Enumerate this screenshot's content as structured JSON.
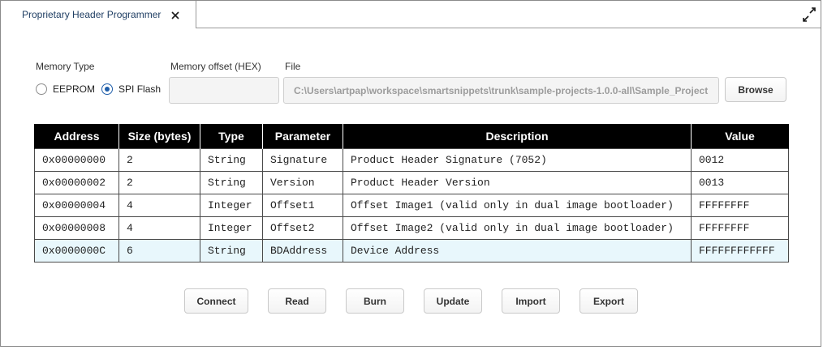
{
  "tab": {
    "title": "Proprietary Header Programmer",
    "close_icon": "close-icon"
  },
  "window": {
    "maximize_icon": "maximize-icon"
  },
  "form": {
    "memory_type_label": "Memory Type",
    "memory_offset_label": "Memory offset (HEX)",
    "file_label": "File",
    "options": [
      {
        "label": "EEPROM",
        "checked": false
      },
      {
        "label": "SPI Flash",
        "checked": true
      }
    ],
    "memory_offset_value": "",
    "file_value": "C:\\Users\\artpap\\workspace\\smartsnippets\\trunk\\sample-projects-1.0.0-all\\Sample_Project",
    "browse_label": "Browse"
  },
  "table": {
    "columns": [
      "Address",
      "Size (bytes)",
      "Type",
      "Parameter",
      "Description",
      "Value"
    ],
    "rows": [
      [
        "0x00000000",
        "2",
        "String",
        "Signature",
        "Product Header Signature (7052)",
        "0012"
      ],
      [
        "0x00000002",
        "2",
        "String",
        "Version",
        "Product Header Version",
        "0013"
      ],
      [
        "0x00000004",
        "4",
        "Integer",
        "Offset1",
        "Offset Image1 (valid only in dual image bootloader)",
        "FFFFFFFF"
      ],
      [
        "0x00000008",
        "4",
        "Integer",
        "Offset2",
        "Offset Image2 (valid only in dual image bootloader)",
        "FFFFFFFF"
      ],
      [
        "0x0000000C",
        "6",
        "String",
        "BDAddress",
        "Device Address",
        "FFFFFFFFFFFF"
      ]
    ],
    "selected_row_index": 4,
    "selected_row_color": "#e8f7fc"
  },
  "actions": {
    "connect": "Connect",
    "read": "Read",
    "burn": "Burn",
    "update": "Update",
    "import": "Import",
    "export": "Export"
  },
  "colors": {
    "accent": "#1f5eaa",
    "tab_text": "#1f3e63",
    "header_bg": "#000000"
  }
}
